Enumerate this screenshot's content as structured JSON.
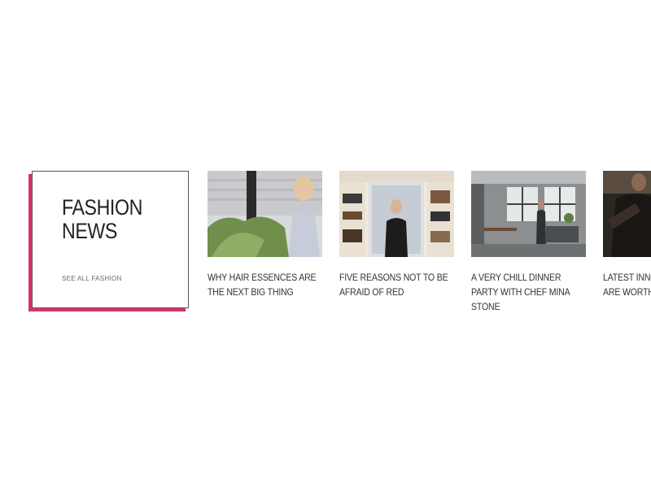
{
  "feature": {
    "title_line1": "FASHION",
    "title_line2": "NEWS",
    "see_all_label": "SEE ALL FASHION",
    "accent_color": "#d6336c"
  },
  "articles": [
    {
      "title": "WHY HAIR ESSENCES ARE THE NEXT BIG THING",
      "image": "woman-with-plant-photo"
    },
    {
      "title": "FIVE REASONS NOT TO BE AFRAID OF RED",
      "image": "woman-in-wardrobe-photo"
    },
    {
      "title": "A VERY CHILL DINNER PARTY WITH CHEF MINA STONE",
      "image": "loft-kitchen-photo"
    },
    {
      "title": "LATEST INNOVATIONS THAT ARE WORTH IT",
      "image": "dark-workshop-photo"
    }
  ]
}
